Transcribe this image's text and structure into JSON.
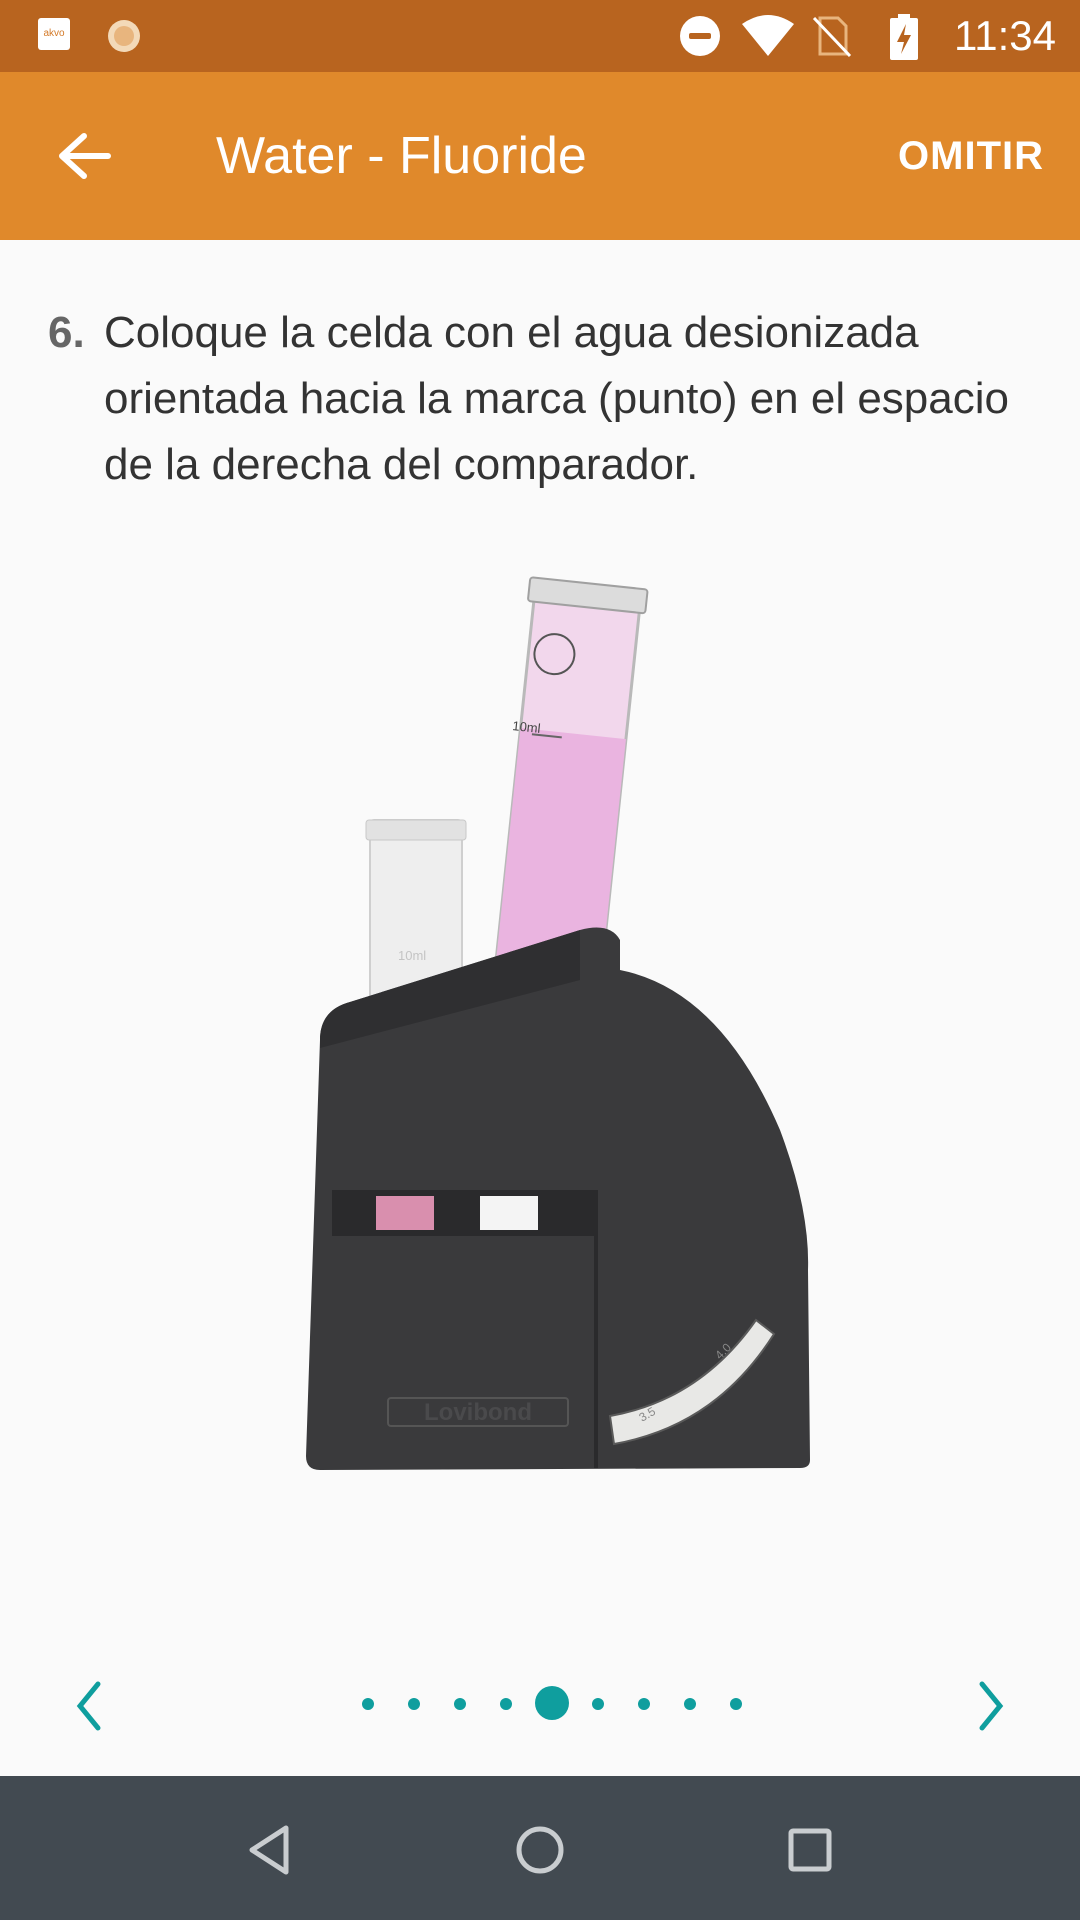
{
  "status_bar": {
    "app_icon_label": "akvo",
    "time": "11:34",
    "icons": [
      "akvo-app-icon",
      "sun-icon",
      "do-not-disturb-icon",
      "wifi-icon",
      "no-sim-icon",
      "battery-charging-icon"
    ]
  },
  "app_bar": {
    "back_icon": "arrow-back-icon",
    "title": "Water - Fluoride",
    "skip_label": "OMITIR"
  },
  "instruction": {
    "step_number": "6.",
    "text": "Coloque la celda con el agua desionizada orientada hacia la marca (punto) en el espacio de la derecha del comparador."
  },
  "illustration": {
    "brand_label": "Lovibond",
    "tube_label_1": "10ml",
    "tube_label_2": "10ml",
    "scale_label_1": "3.5",
    "scale_label_2": "4.0"
  },
  "pager": {
    "prev_icon": "chevron-left-icon",
    "next_icon": "chevron-right-icon",
    "total_pages": 9,
    "current_page": 5,
    "accent_color": "#0f9e9e"
  },
  "nav_bar": {
    "icons": [
      "back-triangle-icon",
      "home-circle-icon",
      "recents-square-icon"
    ]
  },
  "colors": {
    "status_bar": "#b8641f",
    "app_bar": "#e0892b",
    "nav_bar": "#424a51"
  }
}
